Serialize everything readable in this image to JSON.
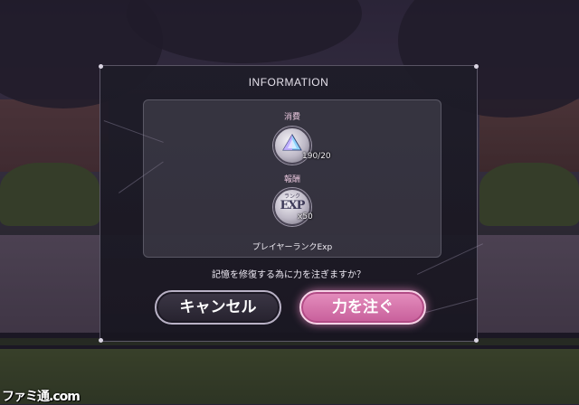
{
  "dialog": {
    "title": "INFORMATION",
    "cost": {
      "label": "消費",
      "item_icon": "crystal-icon",
      "amount": "190/20"
    },
    "reward": {
      "label": "報酬",
      "item_icon": "exp-icon",
      "icon_text": "EXP",
      "icon_subtext": "ランク",
      "amount": "x50",
      "name": "プレイヤーランクExp"
    },
    "question": "記憶を修復する為に力を注ぎますか？",
    "cancel_label": "キャンセル",
    "confirm_label": "力を注ぐ"
  },
  "watermark": "ファミ通.com",
  "colors": {
    "confirm_accent": "#d46fa8",
    "cancel_bg": "#2e2a36",
    "label_pink": "#e8c6dc"
  }
}
